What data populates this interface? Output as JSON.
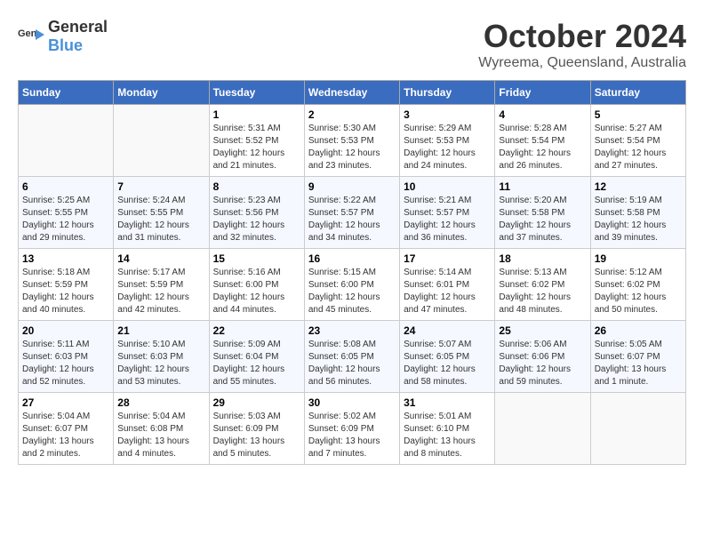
{
  "header": {
    "logo": {
      "general": "General",
      "blue": "Blue"
    },
    "month": "October 2024",
    "location": "Wyreema, Queensland, Australia"
  },
  "days_of_week": [
    "Sunday",
    "Monday",
    "Tuesday",
    "Wednesday",
    "Thursday",
    "Friday",
    "Saturday"
  ],
  "weeks": [
    [
      {
        "day": "",
        "info": ""
      },
      {
        "day": "",
        "info": ""
      },
      {
        "day": "1",
        "info": "Sunrise: 5:31 AM\nSunset: 5:52 PM\nDaylight: 12 hours and 21 minutes."
      },
      {
        "day": "2",
        "info": "Sunrise: 5:30 AM\nSunset: 5:53 PM\nDaylight: 12 hours and 23 minutes."
      },
      {
        "day": "3",
        "info": "Sunrise: 5:29 AM\nSunset: 5:53 PM\nDaylight: 12 hours and 24 minutes."
      },
      {
        "day": "4",
        "info": "Sunrise: 5:28 AM\nSunset: 5:54 PM\nDaylight: 12 hours and 26 minutes."
      },
      {
        "day": "5",
        "info": "Sunrise: 5:27 AM\nSunset: 5:54 PM\nDaylight: 12 hours and 27 minutes."
      }
    ],
    [
      {
        "day": "6",
        "info": "Sunrise: 5:25 AM\nSunset: 5:55 PM\nDaylight: 12 hours and 29 minutes."
      },
      {
        "day": "7",
        "info": "Sunrise: 5:24 AM\nSunset: 5:55 PM\nDaylight: 12 hours and 31 minutes."
      },
      {
        "day": "8",
        "info": "Sunrise: 5:23 AM\nSunset: 5:56 PM\nDaylight: 12 hours and 32 minutes."
      },
      {
        "day": "9",
        "info": "Sunrise: 5:22 AM\nSunset: 5:57 PM\nDaylight: 12 hours and 34 minutes."
      },
      {
        "day": "10",
        "info": "Sunrise: 5:21 AM\nSunset: 5:57 PM\nDaylight: 12 hours and 36 minutes."
      },
      {
        "day": "11",
        "info": "Sunrise: 5:20 AM\nSunset: 5:58 PM\nDaylight: 12 hours and 37 minutes."
      },
      {
        "day": "12",
        "info": "Sunrise: 5:19 AM\nSunset: 5:58 PM\nDaylight: 12 hours and 39 minutes."
      }
    ],
    [
      {
        "day": "13",
        "info": "Sunrise: 5:18 AM\nSunset: 5:59 PM\nDaylight: 12 hours and 40 minutes."
      },
      {
        "day": "14",
        "info": "Sunrise: 5:17 AM\nSunset: 5:59 PM\nDaylight: 12 hours and 42 minutes."
      },
      {
        "day": "15",
        "info": "Sunrise: 5:16 AM\nSunset: 6:00 PM\nDaylight: 12 hours and 44 minutes."
      },
      {
        "day": "16",
        "info": "Sunrise: 5:15 AM\nSunset: 6:00 PM\nDaylight: 12 hours and 45 minutes."
      },
      {
        "day": "17",
        "info": "Sunrise: 5:14 AM\nSunset: 6:01 PM\nDaylight: 12 hours and 47 minutes."
      },
      {
        "day": "18",
        "info": "Sunrise: 5:13 AM\nSunset: 6:02 PM\nDaylight: 12 hours and 48 minutes."
      },
      {
        "day": "19",
        "info": "Sunrise: 5:12 AM\nSunset: 6:02 PM\nDaylight: 12 hours and 50 minutes."
      }
    ],
    [
      {
        "day": "20",
        "info": "Sunrise: 5:11 AM\nSunset: 6:03 PM\nDaylight: 12 hours and 52 minutes."
      },
      {
        "day": "21",
        "info": "Sunrise: 5:10 AM\nSunset: 6:03 PM\nDaylight: 12 hours and 53 minutes."
      },
      {
        "day": "22",
        "info": "Sunrise: 5:09 AM\nSunset: 6:04 PM\nDaylight: 12 hours and 55 minutes."
      },
      {
        "day": "23",
        "info": "Sunrise: 5:08 AM\nSunset: 6:05 PM\nDaylight: 12 hours and 56 minutes."
      },
      {
        "day": "24",
        "info": "Sunrise: 5:07 AM\nSunset: 6:05 PM\nDaylight: 12 hours and 58 minutes."
      },
      {
        "day": "25",
        "info": "Sunrise: 5:06 AM\nSunset: 6:06 PM\nDaylight: 12 hours and 59 minutes."
      },
      {
        "day": "26",
        "info": "Sunrise: 5:05 AM\nSunset: 6:07 PM\nDaylight: 13 hours and 1 minute."
      }
    ],
    [
      {
        "day": "27",
        "info": "Sunrise: 5:04 AM\nSunset: 6:07 PM\nDaylight: 13 hours and 2 minutes."
      },
      {
        "day": "28",
        "info": "Sunrise: 5:04 AM\nSunset: 6:08 PM\nDaylight: 13 hours and 4 minutes."
      },
      {
        "day": "29",
        "info": "Sunrise: 5:03 AM\nSunset: 6:09 PM\nDaylight: 13 hours and 5 minutes."
      },
      {
        "day": "30",
        "info": "Sunrise: 5:02 AM\nSunset: 6:09 PM\nDaylight: 13 hours and 7 minutes."
      },
      {
        "day": "31",
        "info": "Sunrise: 5:01 AM\nSunset: 6:10 PM\nDaylight: 13 hours and 8 minutes."
      },
      {
        "day": "",
        "info": ""
      },
      {
        "day": "",
        "info": ""
      }
    ]
  ]
}
